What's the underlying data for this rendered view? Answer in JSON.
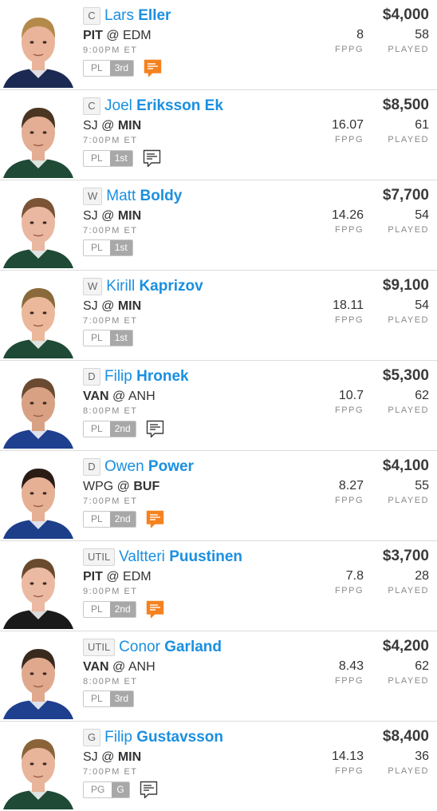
{
  "colors": {
    "accent": "#1a8fe0",
    "note_alert": "#f58220",
    "note_plain": "#3a3a3a"
  },
  "players": [
    {
      "pos": "C",
      "first": "Lars",
      "last": "Eller",
      "home_bold": "PIT",
      "sep": "@",
      "away": "EDM",
      "bold_side": "left",
      "time": "9:00PM ET",
      "tag_left": "PL",
      "tag_right": "3rd",
      "note": "alert",
      "salary": "$4,000",
      "fppg": "8",
      "played": "58",
      "fppg_label": "FPPG",
      "played_label": "PLAYED",
      "jersey": "#1b2a52",
      "skin": "#e9b49a",
      "hair": "#b48a4a"
    },
    {
      "pos": "C",
      "first": "Joel",
      "last": "Eriksson Ek",
      "home_bold": "SJ",
      "sep": "@",
      "away": "MIN",
      "bold_side": "right",
      "time": "7:00PM ET",
      "tag_left": "PL",
      "tag_right": "1st",
      "note": "plain",
      "salary": "$8,500",
      "fppg": "16.07",
      "played": "61",
      "fppg_label": "FPPG",
      "played_label": "PLAYED",
      "jersey": "#1e4a36",
      "skin": "#e3ae94",
      "hair": "#4a3522"
    },
    {
      "pos": "W",
      "first": "Matt",
      "last": "Boldy",
      "home_bold": "SJ",
      "sep": "@",
      "away": "MIN",
      "bold_side": "right",
      "time": "7:00PM ET",
      "tag_left": "PL",
      "tag_right": "1st",
      "note": "none",
      "salary": "$7,700",
      "fppg": "14.26",
      "played": "54",
      "fppg_label": "FPPG",
      "played_label": "PLAYED",
      "jersey": "#1e4a36",
      "skin": "#eab7a0",
      "hair": "#7a5434"
    },
    {
      "pos": "W",
      "first": "Kirill",
      "last": "Kaprizov",
      "home_bold": "SJ",
      "sep": "@",
      "away": "MIN",
      "bold_side": "right",
      "time": "7:00PM ET",
      "tag_left": "PL",
      "tag_right": "1st",
      "note": "none",
      "salary": "$9,100",
      "fppg": "18.11",
      "played": "54",
      "fppg_label": "FPPG",
      "played_label": "PLAYED",
      "jersey": "#1e4a36",
      "skin": "#ebb89c",
      "hair": "#8a6a3a"
    },
    {
      "pos": "D",
      "first": "Filip",
      "last": "Hronek",
      "home_bold": "VAN",
      "sep": "@",
      "away": "ANH",
      "bold_side": "left",
      "time": "8:00PM ET",
      "tag_left": "PL",
      "tag_right": "2nd",
      "note": "plain",
      "salary": "$5,300",
      "fppg": "10.7",
      "played": "62",
      "fppg_label": "FPPG",
      "played_label": "PLAYED",
      "jersey": "#1f3f8f",
      "skin": "#d9a184",
      "hair": "#6a4a30"
    },
    {
      "pos": "D",
      "first": "Owen",
      "last": "Power",
      "home_bold": "WPG",
      "sep": "@",
      "away": "BUF",
      "bold_side": "right",
      "time": "7:00PM ET",
      "tag_left": "PL",
      "tag_right": "2nd",
      "note": "alert",
      "salary": "$4,100",
      "fppg": "8.27",
      "played": "55",
      "fppg_label": "FPPG",
      "played_label": "PLAYED",
      "jersey": "#1d3f8a",
      "skin": "#e6b095",
      "hair": "#2a1c14"
    },
    {
      "pos": "UTIL",
      "first": "Valtteri",
      "last": "Puustinen",
      "home_bold": "PIT",
      "sep": "@",
      "away": "EDM",
      "bold_side": "left",
      "time": "9:00PM ET",
      "tag_left": "PL",
      "tag_right": "2nd",
      "note": "alert",
      "salary": "$3,700",
      "fppg": "7.8",
      "played": "28",
      "fppg_label": "FPPG",
      "played_label": "PLAYED",
      "jersey": "#1a1a1a",
      "skin": "#ecbaa2",
      "hair": "#6a4a2e"
    },
    {
      "pos": "UTIL",
      "first": "Conor",
      "last": "Garland",
      "home_bold": "VAN",
      "sep": "@",
      "away": "ANH",
      "bold_side": "left",
      "time": "8:00PM ET",
      "tag_left": "PL",
      "tag_right": "3rd",
      "note": "none",
      "salary": "$4,200",
      "fppg": "8.43",
      "played": "62",
      "fppg_label": "FPPG",
      "played_label": "PLAYED",
      "jersey": "#1f3f8f",
      "skin": "#e0a98e",
      "hair": "#3a2a1e"
    },
    {
      "pos": "G",
      "first": "Filip",
      "last": "Gustavsson",
      "home_bold": "SJ",
      "sep": "@",
      "away": "MIN",
      "bold_side": "right",
      "time": "7:00PM ET",
      "tag_left": "PG",
      "tag_right": "G",
      "note": "plain",
      "salary": "$8,400",
      "fppg": "14.13",
      "played": "36",
      "fppg_label": "FPPG",
      "played_label": "PLAYED",
      "jersey": "#1e4a36",
      "skin": "#e8b49a",
      "hair": "#8a6438"
    }
  ]
}
